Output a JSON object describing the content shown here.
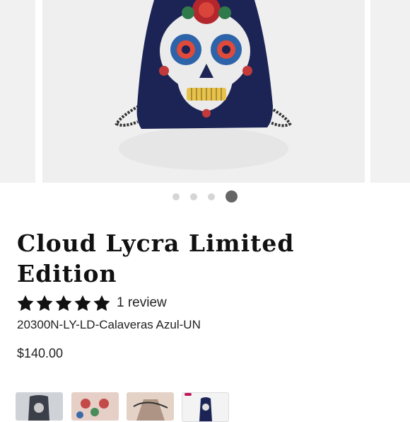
{
  "product": {
    "title": "Cloud Lycra Limited Edition",
    "rating_stars": 5,
    "review_text": "1 review",
    "sku": "20300N-LY-LD-Calaveras Azul-UN",
    "price": "$140.00"
  },
  "gallery": {
    "image_count": 4,
    "active_index": 3,
    "main_image_icon": "sugar-skull-drawstring-bag"
  },
  "thumbnails": [
    {
      "icon": "bag-thumbnail-1"
    },
    {
      "icon": "bag-thumbnail-2"
    },
    {
      "icon": "bag-thumbnail-3"
    },
    {
      "icon": "bag-thumbnail-4"
    }
  ],
  "colors": {
    "bag_navy": "#1c2456",
    "dot_active": "#666666",
    "dot_inactive": "#d5d5d5"
  }
}
